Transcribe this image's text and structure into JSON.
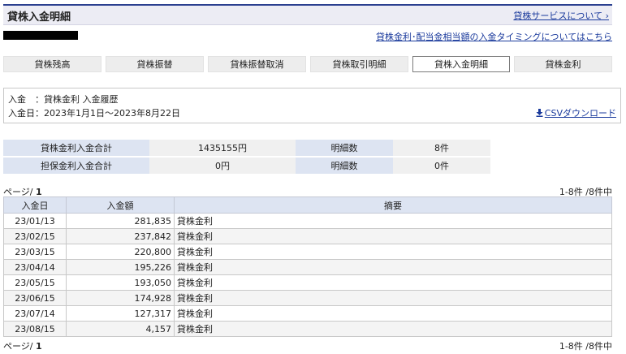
{
  "header": {
    "title": "貸株入金明細",
    "service_link": "貸株サービスについて ›"
  },
  "timing_link": "貸株金利･配当金相当額の入金タイミングについてはこちら",
  "tabs": [
    "貸株残高",
    "貸株振替",
    "貸株振替取消",
    "貸株取引明細",
    "貸株入金明細",
    "貸株金利"
  ],
  "active_tab": "貸株入金明細",
  "info": {
    "line1": "入金　：貸株金利  入金履歴",
    "line2": "入金日：2023年1月1日～2023年8月22日",
    "csv_label": "CSVダウンロード"
  },
  "summary": [
    {
      "label": "貸株金利入金合計",
      "value": "1435155円",
      "count_label": "明細数",
      "count": "8件"
    },
    {
      "label": "担保金利入金合計",
      "value": "0円",
      "count_label": "明細数",
      "count": "0件"
    }
  ],
  "pagination": {
    "label": "ページ/ ",
    "page": "1",
    "count": "1-8件 /8件中"
  },
  "table": {
    "headers": [
      "入金日",
      "入金額",
      "摘要"
    ],
    "rows": [
      {
        "date": "23/01/13",
        "amount": "281,835",
        "desc": "貸株金利"
      },
      {
        "date": "23/02/15",
        "amount": "237,842",
        "desc": "貸株金利"
      },
      {
        "date": "23/03/15",
        "amount": "220,800",
        "desc": "貸株金利"
      },
      {
        "date": "23/04/14",
        "amount": "195,226",
        "desc": "貸株金利"
      },
      {
        "date": "23/05/15",
        "amount": "193,050",
        "desc": "貸株金利"
      },
      {
        "date": "23/06/15",
        "amount": "174,928",
        "desc": "貸株金利"
      },
      {
        "date": "23/07/14",
        "amount": "127,317",
        "desc": "貸株金利"
      },
      {
        "date": "23/08/15",
        "amount": "4,157",
        "desc": "貸株金利"
      }
    ]
  },
  "colors": {
    "header_border": "#2a3f8f",
    "link": "#1a3a9c",
    "label_bg": "#dde4f2"
  }
}
